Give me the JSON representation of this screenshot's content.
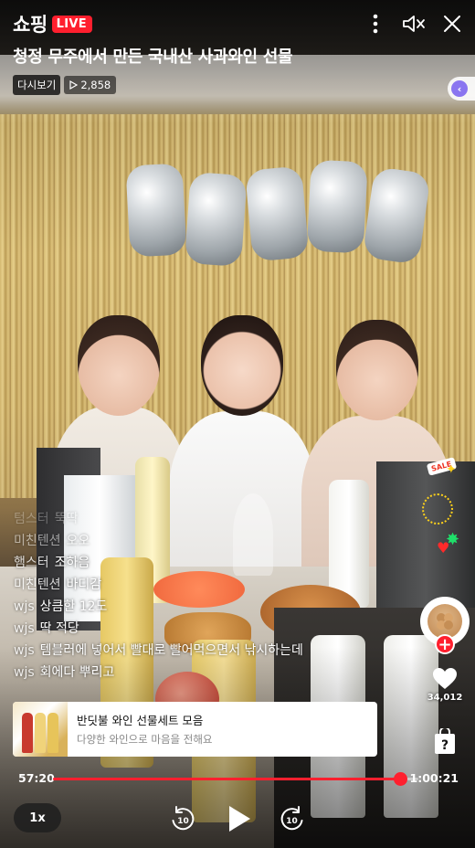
{
  "header": {
    "brand": "쇼핑",
    "live_badge": "LIVE",
    "title": "청정 무주에서 만든 국내산 사과와인 선물",
    "replay_label": "다시보기",
    "view_count": "2,858"
  },
  "icons": {
    "more": "more-vertical-icon",
    "mute": "speaker-muted-icon",
    "close": "close-icon",
    "play": "play-icon",
    "rewind": "rewind-10-icon",
    "forward": "forward-10-icon",
    "like": "heart-icon",
    "quiz": "quiz-bag-icon"
  },
  "chat": {
    "messages": [
      {
        "nick": "텀스터",
        "text": "뚝딱"
      },
      {
        "nick": "미친텐션",
        "text": "오오"
      },
      {
        "nick": "햄스터",
        "text": "조하음"
      },
      {
        "nick": "미친텐션",
        "text": "바디감"
      },
      {
        "nick": "wjs",
        "text": "상큼한 12도"
      },
      {
        "nick": "wjs",
        "text": "딱 적당"
      },
      {
        "nick": "wjs",
        "text": "템블러에 넣어서 빨대로 빨어먹으면서 낚시하는데"
      },
      {
        "nick": "wjs",
        "text": "회에다 뿌리고"
      }
    ]
  },
  "rail": {
    "sale_tag": "SALE",
    "brand_avatar_text": "",
    "like_count": "34,012"
  },
  "product": {
    "name": "반딧불 와인 선물세트 모음",
    "description": "다양한 와인으로 마음을 전해요"
  },
  "player": {
    "current_time": "57:20",
    "total_time": "1:00:21",
    "progress": 0.95,
    "speed": "1x"
  },
  "colors": {
    "accent": "#ff1f2e"
  }
}
